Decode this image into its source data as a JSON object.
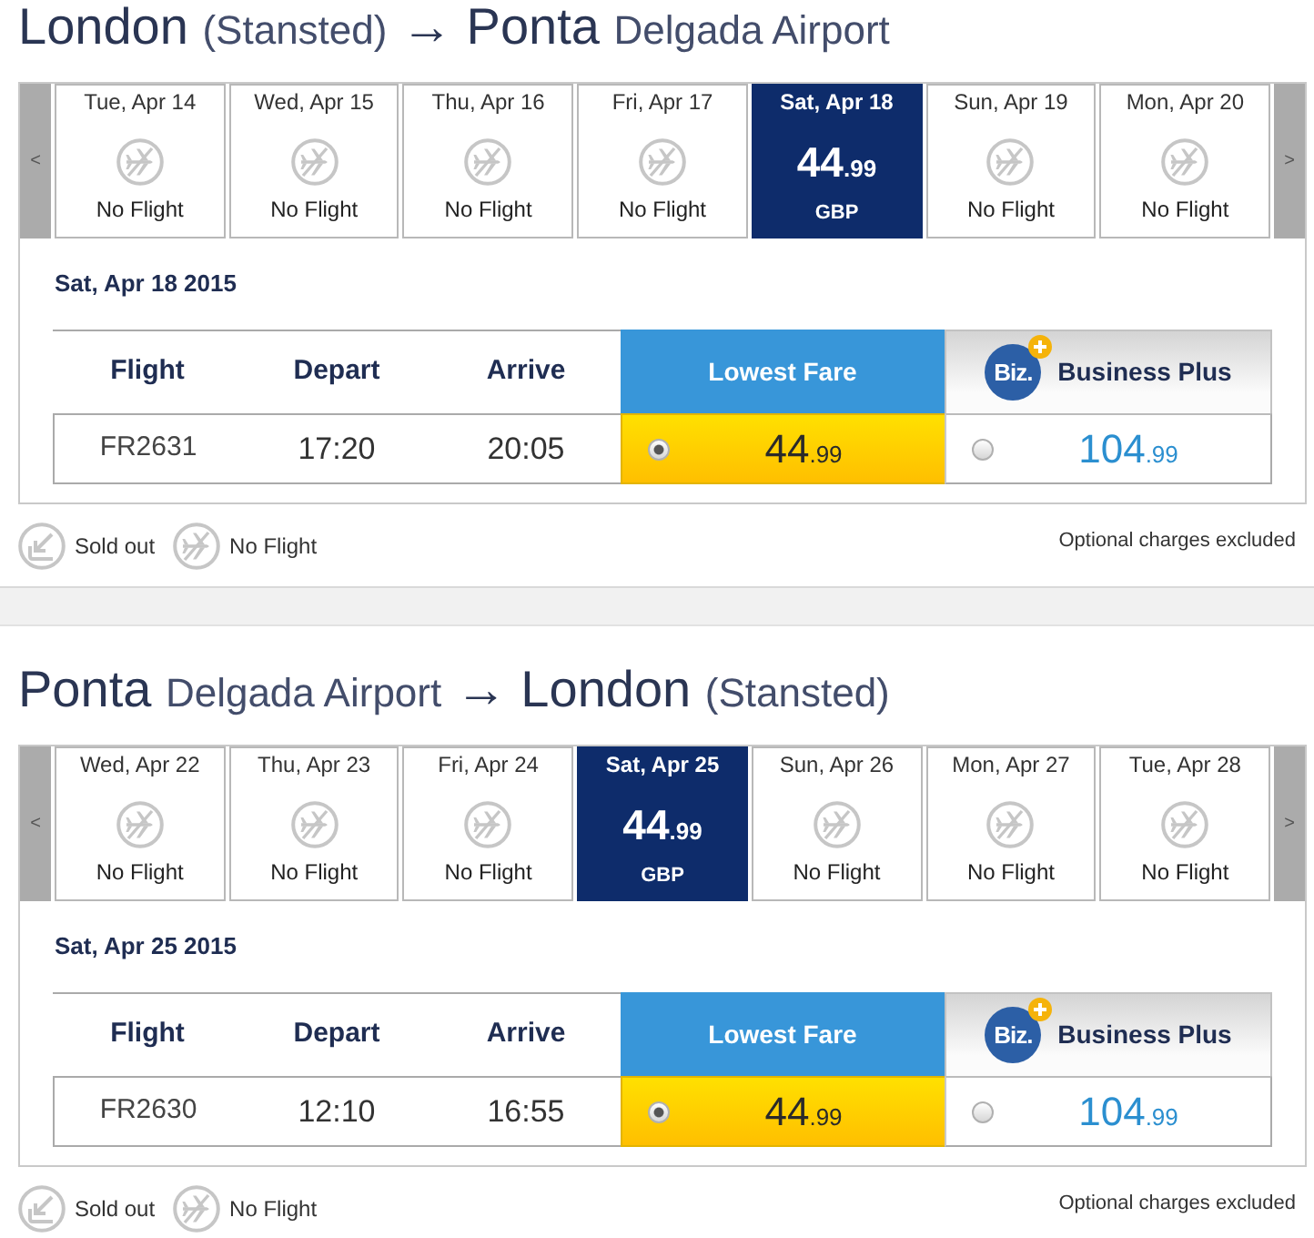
{
  "sections": [
    {
      "route": {
        "origin": "London",
        "origin_detail": "(Stansted)",
        "arrow": "→",
        "destination": "Ponta",
        "destination_detail": "Delgada Airport"
      },
      "date_strip": {
        "prev": "<",
        "next": ">",
        "days": [
          {
            "date": "Tue, Apr 14",
            "kind": "no_flight",
            "status": "No Flight",
            "selected": false
          },
          {
            "date": "Wed, Apr 15",
            "kind": "no_flight",
            "status": "No Flight",
            "selected": false
          },
          {
            "date": "Thu, Apr 16",
            "kind": "no_flight",
            "status": "No Flight",
            "selected": false
          },
          {
            "date": "Fri, Apr 17",
            "kind": "no_flight",
            "status": "No Flight",
            "selected": false
          },
          {
            "date": "Sat, Apr 18",
            "kind": "fare",
            "amount": "44",
            "decimals": ".99",
            "currency": "GBP",
            "selected": true
          },
          {
            "date": "Sun, Apr 19",
            "kind": "no_flight",
            "status": "No Flight",
            "selected": false
          },
          {
            "date": "Mon, Apr 20",
            "kind": "no_flight",
            "status": "No Flight",
            "selected": false
          }
        ]
      },
      "selected_date": "Sat, Apr 18 2015",
      "fare_table": {
        "columns": [
          {
            "label": "Flight",
            "kind": "info"
          },
          {
            "label": "Depart",
            "kind": "info"
          },
          {
            "label": "Arrive",
            "kind": "info"
          },
          {
            "label": "Lowest Fare",
            "kind": "lowest"
          },
          {
            "label": "Business Plus",
            "kind": "business",
            "logo": "Biz."
          }
        ],
        "rows": [
          {
            "flight": "FR2631",
            "depart": "17:20",
            "arrive": "20:05",
            "fares": [
              {
                "amount": "44",
                "decimals": ".99",
                "selected": true
              },
              {
                "amount": "104",
                "decimals": ".99",
                "selected": false
              }
            ]
          }
        ]
      },
      "legend": [
        {
          "kind": "sold_out",
          "label": "Sold out"
        },
        {
          "kind": "no_flight",
          "label": "No Flight"
        }
      ],
      "note": "Optional charges excluded"
    },
    {
      "route": {
        "origin": "Ponta",
        "origin_detail": "Delgada Airport",
        "arrow": "→",
        "destination": "London",
        "destination_detail": "(Stansted)"
      },
      "date_strip": {
        "prev": "<",
        "next": ">",
        "days": [
          {
            "date": "Wed, Apr 22",
            "kind": "no_flight",
            "status": "No Flight",
            "selected": false
          },
          {
            "date": "Thu, Apr 23",
            "kind": "no_flight",
            "status": "No Flight",
            "selected": false
          },
          {
            "date": "Fri, Apr 24",
            "kind": "no_flight",
            "status": "No Flight",
            "selected": false
          },
          {
            "date": "Sat, Apr 25",
            "kind": "fare",
            "amount": "44",
            "decimals": ".99",
            "currency": "GBP",
            "selected": true
          },
          {
            "date": "Sun, Apr 26",
            "kind": "no_flight",
            "status": "No Flight",
            "selected": false
          },
          {
            "date": "Mon, Apr 27",
            "kind": "no_flight",
            "status": "No Flight",
            "selected": false
          },
          {
            "date": "Tue, Apr 28",
            "kind": "no_flight",
            "status": "No Flight",
            "selected": false
          }
        ]
      },
      "selected_date": "Sat, Apr 25 2015",
      "fare_table": {
        "columns": [
          {
            "label": "Flight",
            "kind": "info"
          },
          {
            "label": "Depart",
            "kind": "info"
          },
          {
            "label": "Arrive",
            "kind": "info"
          },
          {
            "label": "Lowest Fare",
            "kind": "lowest"
          },
          {
            "label": "Business Plus",
            "kind": "business",
            "logo": "Biz."
          }
        ],
        "rows": [
          {
            "flight": "FR2630",
            "depart": "12:10",
            "arrive": "16:55",
            "fares": [
              {
                "amount": "44",
                "decimals": ".99",
                "selected": true
              },
              {
                "amount": "104",
                "decimals": ".99",
                "selected": false
              }
            ]
          }
        ]
      },
      "legend": [
        {
          "kind": "sold_out",
          "label": "Sold out"
        },
        {
          "kind": "no_flight",
          "label": "No Flight"
        }
      ],
      "note": "Optional charges excluded"
    }
  ]
}
